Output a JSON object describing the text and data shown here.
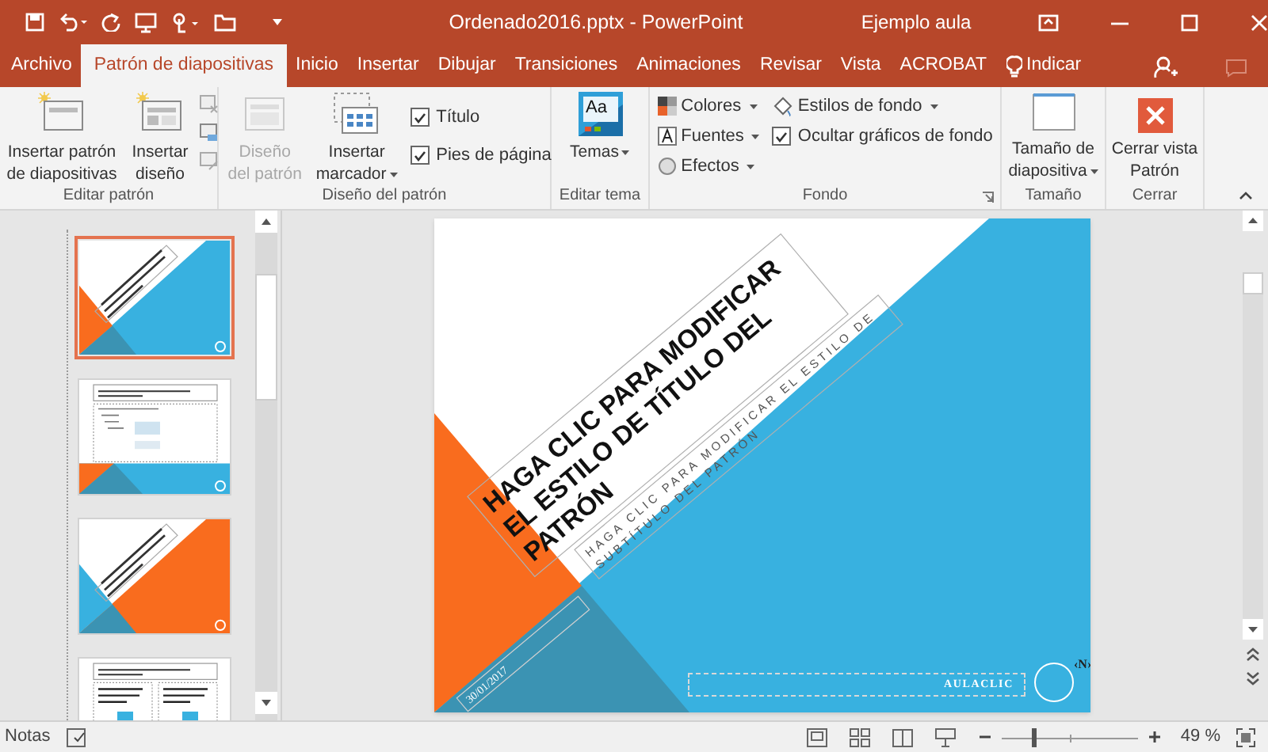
{
  "title_bar": {
    "document_title": "Ordenado2016.pptx  -  PowerPoint",
    "account": "Ejemplo aula"
  },
  "tabs": [
    {
      "label": "Archivo",
      "selected": false
    },
    {
      "label": "Patrón de diapositivas",
      "selected": true
    },
    {
      "label": "Inicio",
      "selected": false
    },
    {
      "label": "Insertar",
      "selected": false
    },
    {
      "label": "Dibujar",
      "selected": false
    },
    {
      "label": "Transiciones",
      "selected": false
    },
    {
      "label": "Animaciones",
      "selected": false
    },
    {
      "label": "Revisar",
      "selected": false
    },
    {
      "label": "Vista",
      "selected": false
    },
    {
      "label": "ACROBAT",
      "selected": false
    }
  ],
  "tell_me": "Indicar",
  "ribbon": {
    "groups": [
      {
        "label": "Editar patrón",
        "buttons": [
          {
            "label": "Insertar patrón\nde diapositivas",
            "disabled": false,
            "dropdown": false
          },
          {
            "label": "Insertar\ndiseño",
            "disabled": false,
            "dropdown": false
          }
        ]
      },
      {
        "label": "Diseño del patrón",
        "buttons": [
          {
            "label": "Diseño\ndel patrón",
            "disabled": true,
            "dropdown": false
          },
          {
            "label": "Insertar\nmarcador",
            "disabled": false,
            "dropdown": true
          }
        ],
        "checkboxes": [
          {
            "label": "Título",
            "checked": true
          },
          {
            "label": "Pies de página",
            "checked": true
          }
        ]
      },
      {
        "label": "Editar tema",
        "buttons": [
          {
            "label": "Temas",
            "preview_text": "Aa",
            "disabled": false,
            "dropdown": true
          }
        ]
      },
      {
        "label": "Fondo",
        "buttons": [
          {
            "label": "Colores",
            "disabled": false,
            "dropdown": true
          },
          {
            "label": "Fuentes",
            "disabled": false,
            "dropdown": true
          },
          {
            "label": "Efectos",
            "disabled": false,
            "dropdown": true
          },
          {
            "label": "Estilos de fondo",
            "disabled": false,
            "dropdown": true
          }
        ],
        "checkboxes": [
          {
            "label": "Ocultar gráficos de fondo",
            "checked": true
          }
        ]
      },
      {
        "label": "Tamaño",
        "buttons": [
          {
            "label": "Tamaño de\ndiapositiva",
            "disabled": false,
            "dropdown": true
          }
        ]
      },
      {
        "label": "Cerrar",
        "buttons": [
          {
            "label": "Cerrar vista\nPatrón",
            "disabled": false,
            "dropdown": false
          }
        ]
      }
    ]
  },
  "thumbnails": [
    {
      "kind": "title",
      "color": "#38b1e0",
      "selected": true
    },
    {
      "kind": "content",
      "color": "#38b1e0",
      "selected": false
    },
    {
      "kind": "title",
      "color": "#f96c1e",
      "selected": false
    },
    {
      "kind": "two-content",
      "color": "#38b1e0",
      "selected": false
    }
  ],
  "slide": {
    "title": "HAGA CLIC PARA MODIFICAR EL ESTILO DE TÍTULO DEL PATRÓN",
    "subtitle": "HAGA CLIC PARA MODIFICAR EL ESTILO DE SUBTÍTULO DEL PATRÓN",
    "date": "30/01/2017",
    "footer": "AULACLIC",
    "slide_number": "‹N›"
  },
  "status_bar": {
    "notes": "Notas",
    "zoom": "49 %",
    "zoom_slider": {
      "level": 0.22
    }
  }
}
